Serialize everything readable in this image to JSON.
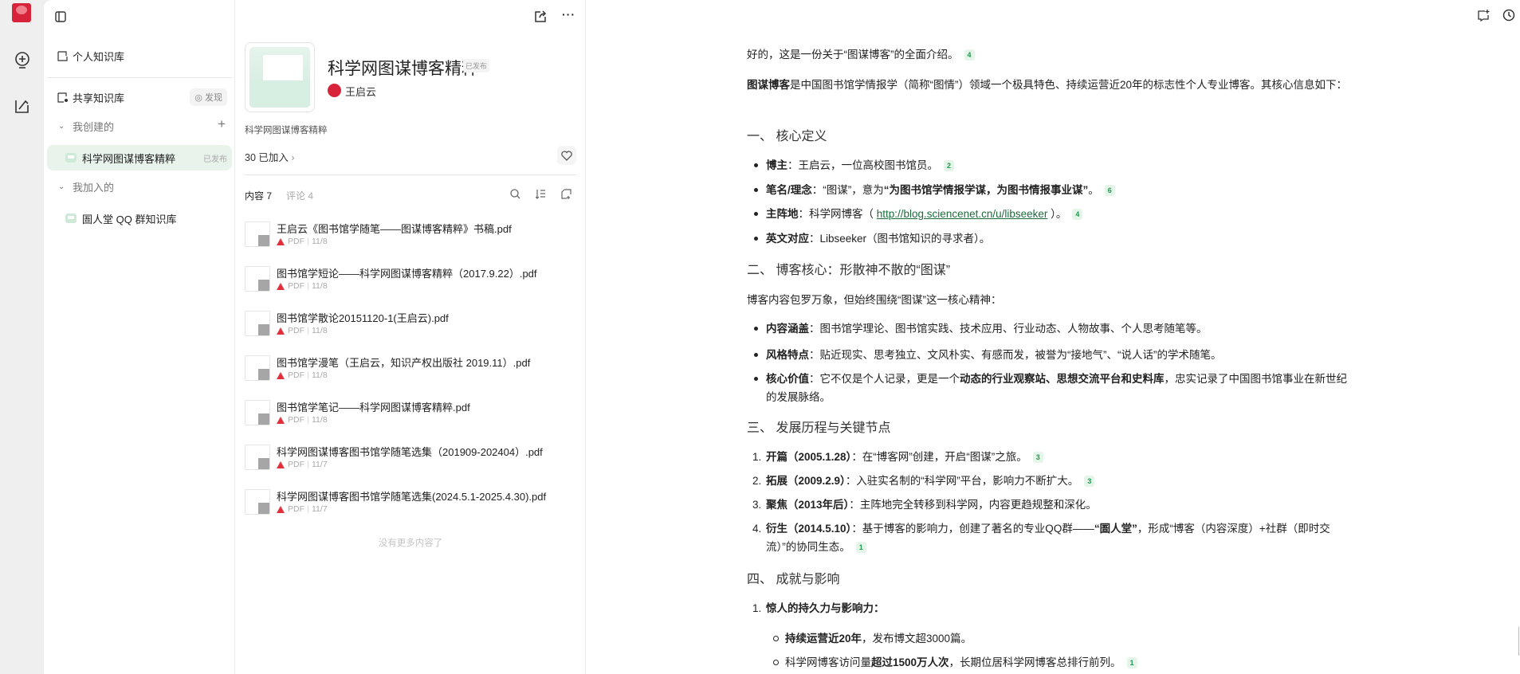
{
  "sidebar": {
    "personal_kb": "个人知识库",
    "shared_kb": "共享知识库",
    "discover": "发现",
    "created_section": "我创建的",
    "created_items": [
      {
        "label": "科学网图谋博客精粹",
        "badge": "已发布"
      }
    ],
    "joined_section": "我加入的",
    "joined_items": [
      {
        "label": "圄人堂 QQ 群知识库"
      }
    ]
  },
  "kb": {
    "title": "科学网图谋博客精粹",
    "status": "已发布",
    "author": "王启云",
    "description": "科学网图谋博客精粹",
    "members": "30 已加入",
    "tab_content": "内容 7",
    "tab_comments": "评论 4",
    "end_text": "没有更多内容了",
    "files": [
      {
        "name": "王启云《图书馆学随笔——图谋博客精粹》书稿.pdf",
        "type": "PDF",
        "date": "11/8"
      },
      {
        "name": "图书馆学短论——科学网图谋博客精粹（2017.9.22）.pdf",
        "type": "PDF",
        "date": "11/8"
      },
      {
        "name": "图书馆学散论20151120-1(王启云).pdf",
        "type": "PDF",
        "date": "11/8"
      },
      {
        "name": "图书馆学漫笔（王启云，知识产权出版社 2019.11）.pdf",
        "type": "PDF",
        "date": "11/8"
      },
      {
        "name": "图书馆学笔记——科学网图谋博客精粹.pdf",
        "type": "PDF",
        "date": "11/8"
      },
      {
        "name": "科学网图谋博客图书馆学随笔选集（201909-202404）.pdf",
        "type": "PDF",
        "date": "11/7"
      },
      {
        "name": "科学网图谋博客图书馆学随笔选集(2024.5.1-2025.4.30).pdf",
        "type": "PDF",
        "date": "11/7"
      }
    ]
  },
  "doc": {
    "intro": "好的，这是一份关于“图谋博客”的全面介绍。",
    "intro_cite": "4",
    "para1_bold": "图谋博客",
    "para1": "是中国图书馆学情报学（简称“图情”）领域一个极具特色、持续运营近20年的标志性个人专业博客。其核心信息如下：",
    "h1": "一、 核心定义",
    "s1": [
      {
        "label": "博主",
        "text": "：王启云，一位高校图书馆员。",
        "cite": "2"
      },
      {
        "label": "笔名/理念",
        "text": "：“图谋”，意为",
        "bold2": "“为图书馆学情报学谋，为图书情报事业谋”",
        "text2": "。",
        "cite": "6"
      },
      {
        "label": "主阵地",
        "text": "：科学网博客（ ",
        "link": "http://blog.sciencenet.cn/u/libseeker",
        "text2": " ）。",
        "cite": "4"
      },
      {
        "label": "英文对应",
        "text": "：Libseeker（图书馆知识的寻求者）。"
      }
    ],
    "h2": "二、 博客核心：形散神不散的“图谋”",
    "para2": "博客内容包罗万象，但始终围绕“图谋”这一核心精神：",
    "s2": [
      {
        "label": "内容涵盖",
        "text": "：图书馆学理论、图书馆实践、技术应用、行业动态、人物故事、个人思考随笔等。"
      },
      {
        "label": "风格特点",
        "text": "：贴近现实、思考独立、文风朴实、有感而发，被誉为“接地气”、“说人话”的学术随笔。"
      },
      {
        "label": "核心价值",
        "text": "：它不仅是个人记录，更是一个",
        "bold2": "动态的行业观察站、思想交流平台和史料库",
        "text2": "，忠实记录了中国图书馆事业在新世纪的发展脉络。"
      }
    ],
    "h3": "三、 发展历程与关键节点",
    "s3": [
      {
        "label": "开篇（2005.1.28）",
        "text": "：在“博客网”创建，开启“图谋”之旅。",
        "cite": "3"
      },
      {
        "label": "拓展（2009.2.9）",
        "text": "：入驻实名制的“科学网”平台，影响力不断扩大。",
        "cite": "3"
      },
      {
        "label": "聚焦（2013年后）",
        "text": "：主阵地完全转移到科学网，内容更趋规整和深化。"
      },
      {
        "label": "衍生（2014.5.10）",
        "text": "：基于博客的影响力，创建了著名的专业QQ群——",
        "bold2": "“圄人堂”",
        "text2": "，形成“博客（内容深度）+社群（即时交流）”的协同生态。",
        "cite": "1"
      }
    ],
    "h4": "四、 成就与影响",
    "s4_title": "惊人的持久力与影响力：",
    "s4": [
      {
        "label": "持续运营近20年",
        "text": "，发布博文超3000篇。"
      },
      {
        "pre": "科学网博客访问量",
        "label": "超过1500万人次",
        "text": "，长期位居科学网博客总排行前列。",
        "cite": "1"
      }
    ]
  },
  "colors": {
    "accent": "#1f9a4e",
    "selected_bg": "#e8f3ec",
    "logo": "#d8243a"
  }
}
